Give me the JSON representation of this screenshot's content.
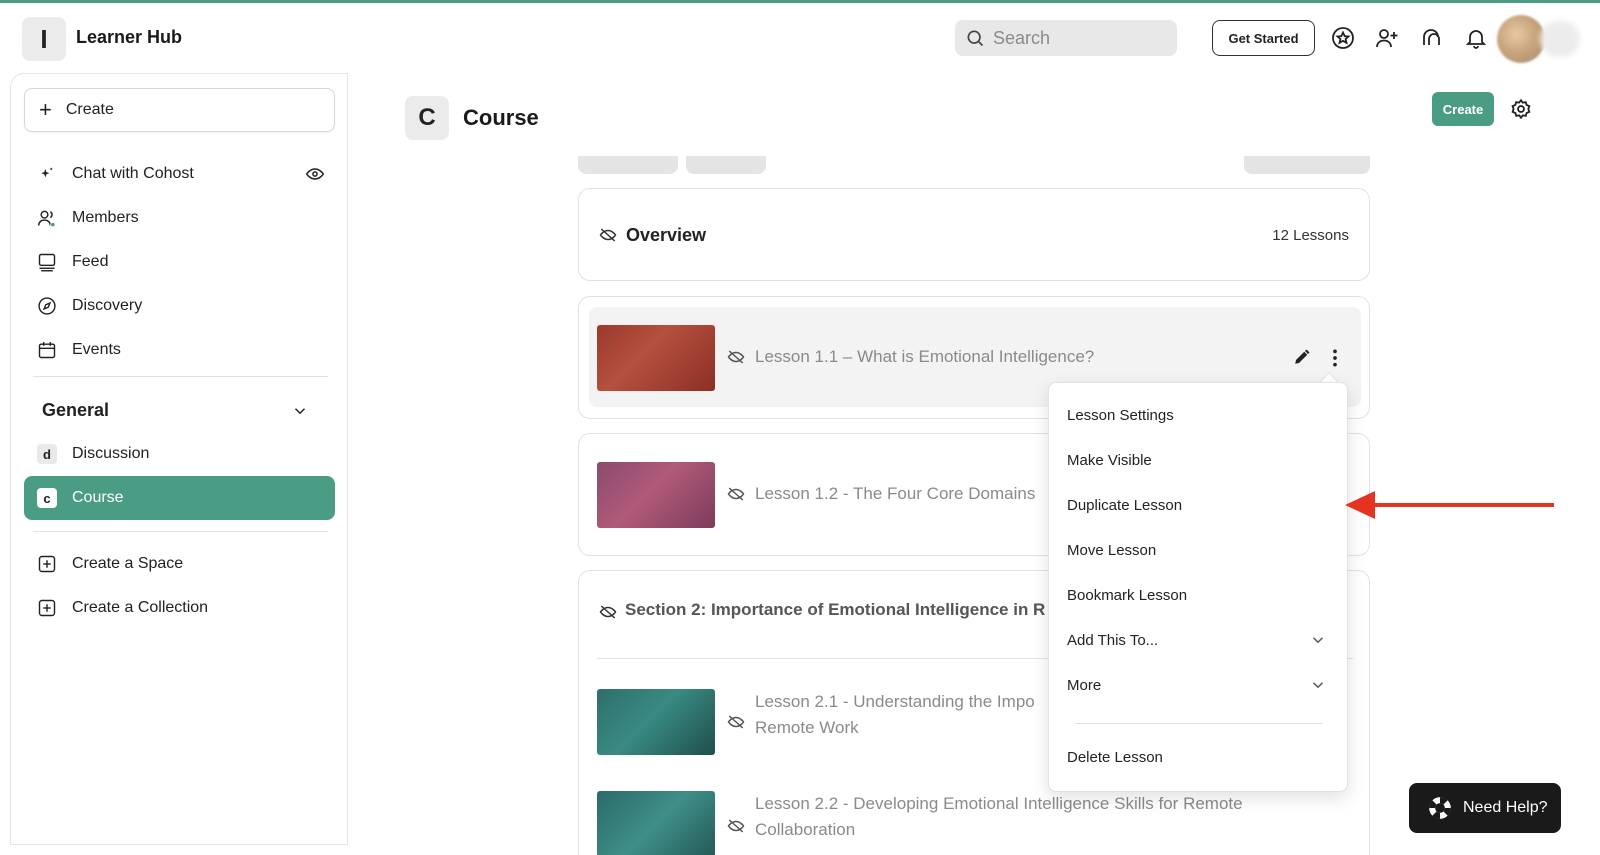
{
  "app": {
    "title": "Learner Hub",
    "logo_letter": "I"
  },
  "header": {
    "search_placeholder": "Search",
    "get_started_label": "Get Started",
    "icons": [
      "star-badge-icon",
      "add-user-icon",
      "chat-icon",
      "bell-icon"
    ]
  },
  "sidebar": {
    "create_label": "Create",
    "items": [
      {
        "label": "Chat with Cohost",
        "icon": "sparkle-icon"
      },
      {
        "label": "Members",
        "icon": "members-icon"
      },
      {
        "label": "Feed",
        "icon": "feed-icon"
      },
      {
        "label": "Discovery",
        "icon": "compass-icon"
      },
      {
        "label": "Events",
        "icon": "calendar-icon"
      }
    ],
    "section_label": "General",
    "spaces": [
      {
        "letter": "d",
        "label": "Discussion"
      },
      {
        "letter": "c",
        "label": "Course"
      }
    ],
    "actions": [
      {
        "label": "Create a Space"
      },
      {
        "label": "Create a Collection"
      }
    ]
  },
  "main": {
    "badge_letter": "C",
    "title": "Course",
    "create_label": "Create",
    "overview": {
      "title": "Overview",
      "count": "12 Lessons"
    },
    "lessons": [
      {
        "title": "Lesson 1.1 – What is Emotional Intelligence?"
      },
      {
        "title": "Lesson 1.2 - The Four Core Domains"
      },
      {
        "title_line1": "Lesson 2.1 - Understanding the Impo",
        "title_line2": "Remote Work"
      },
      {
        "title_line1": "Lesson 2.2 - Developing Emotional Intelligence Skills for Remote",
        "title_line2": "Collaboration"
      }
    ],
    "section2_title": "Section 2: Importance of Emotional Intelligence in R"
  },
  "menu": {
    "items": [
      "Lesson Settings",
      "Make Visible",
      "Duplicate Lesson",
      "Move Lesson",
      "Bookmark Lesson",
      "Add This To...",
      "More",
      "Delete Lesson"
    ]
  },
  "help": {
    "label": "Need Help?"
  },
  "colors": {
    "accent": "#4a9d84",
    "arrow": "#e53322"
  }
}
